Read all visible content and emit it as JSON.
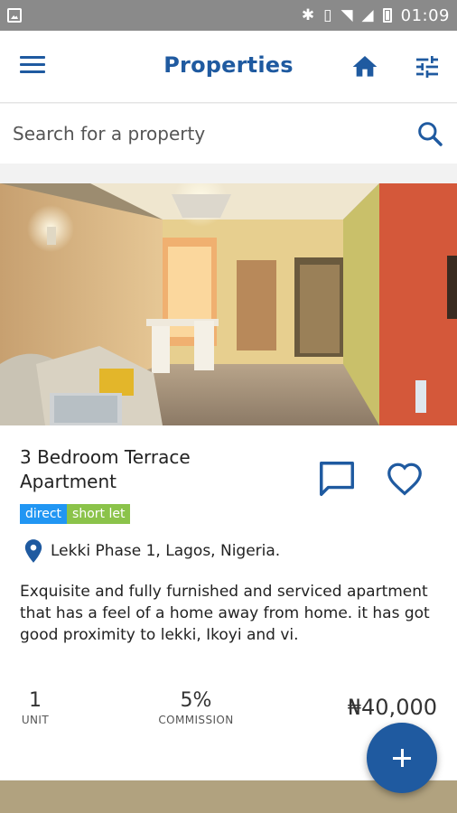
{
  "status_bar": {
    "time": "01:09",
    "icons": [
      "image-icon",
      "bluetooth-icon",
      "vibrate-icon",
      "wifi-icon",
      "signal-icon",
      "battery-icon"
    ]
  },
  "app_bar": {
    "title": "Properties",
    "accent": "#1f5aa0",
    "icons": [
      "menu-icon",
      "home-icon",
      "filter-icon"
    ]
  },
  "search": {
    "placeholder": "Search for a property",
    "value": ""
  },
  "listing": {
    "title": "3 Bedroom Terrace Apartment",
    "tags": [
      {
        "label": "direct",
        "color": "#2196f3"
      },
      {
        "label": "short let",
        "color": "#8bc34a"
      }
    ],
    "location": "Lekki Phase 1, Lagos, Nigeria.",
    "description": "Exquisite and fully furnished and serviced apartment that has a feel of a home away from home. it has got good proximity to lekki, Ikoyi and vi.",
    "unit_value": "1",
    "unit_label": "UNIT",
    "commission_value": "5%",
    "commission_label": "COMMISSION",
    "price": "₦40,000",
    "actions": [
      "message-icon",
      "heart-icon"
    ]
  },
  "fab": {
    "icon": "plus-icon"
  }
}
